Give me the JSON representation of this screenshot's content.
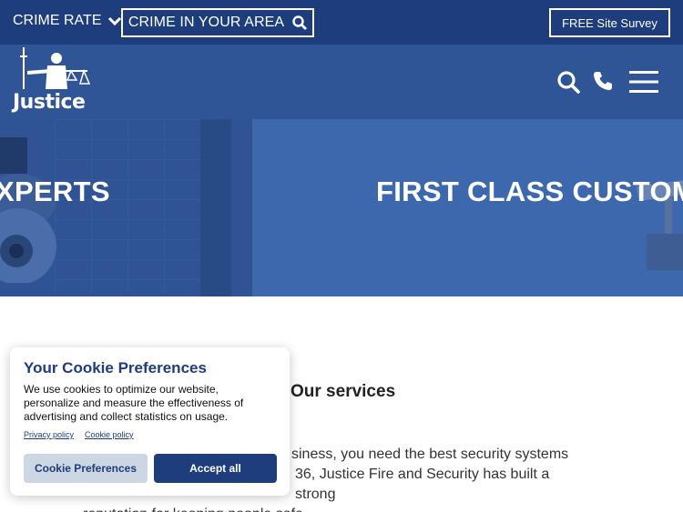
{
  "topbar": {
    "crime_rate_label": "CRIME RATE",
    "crime_area_label": "CRIME IN YOUR AREA",
    "survey_label": "FREE Site Survey"
  },
  "header": {
    "logo_text": "Justice",
    "icons": [
      "search-icon",
      "phone-icon",
      "menu-icon"
    ]
  },
  "hero": {
    "slide_text_left": "XPERTS",
    "slide_text_right": "FIRST CLASS CUSTOMER"
  },
  "main": {
    "services_title": "Our services",
    "body_line1": "siness, you need the best security systems",
    "body_line2": "36, Justice Fire and Security has built a strong",
    "body_line3": "reputation for keeping people safe."
  },
  "cookie": {
    "title": "Your Cookie Preferences",
    "description": "We use cookies to optimize our website, personalize and measure the effectiveness of advertising and collect statistics on usage.",
    "privacy_link": "Privacy policy",
    "cookie_link": "Cookie policy",
    "preferences_button": "Cookie Preferences",
    "accept_button": "Accept all"
  },
  "colors": {
    "topbar": "#1d3d7c",
    "header": "#2f5596",
    "hero": "#3e68ad",
    "accent": "#1d3d7c"
  }
}
